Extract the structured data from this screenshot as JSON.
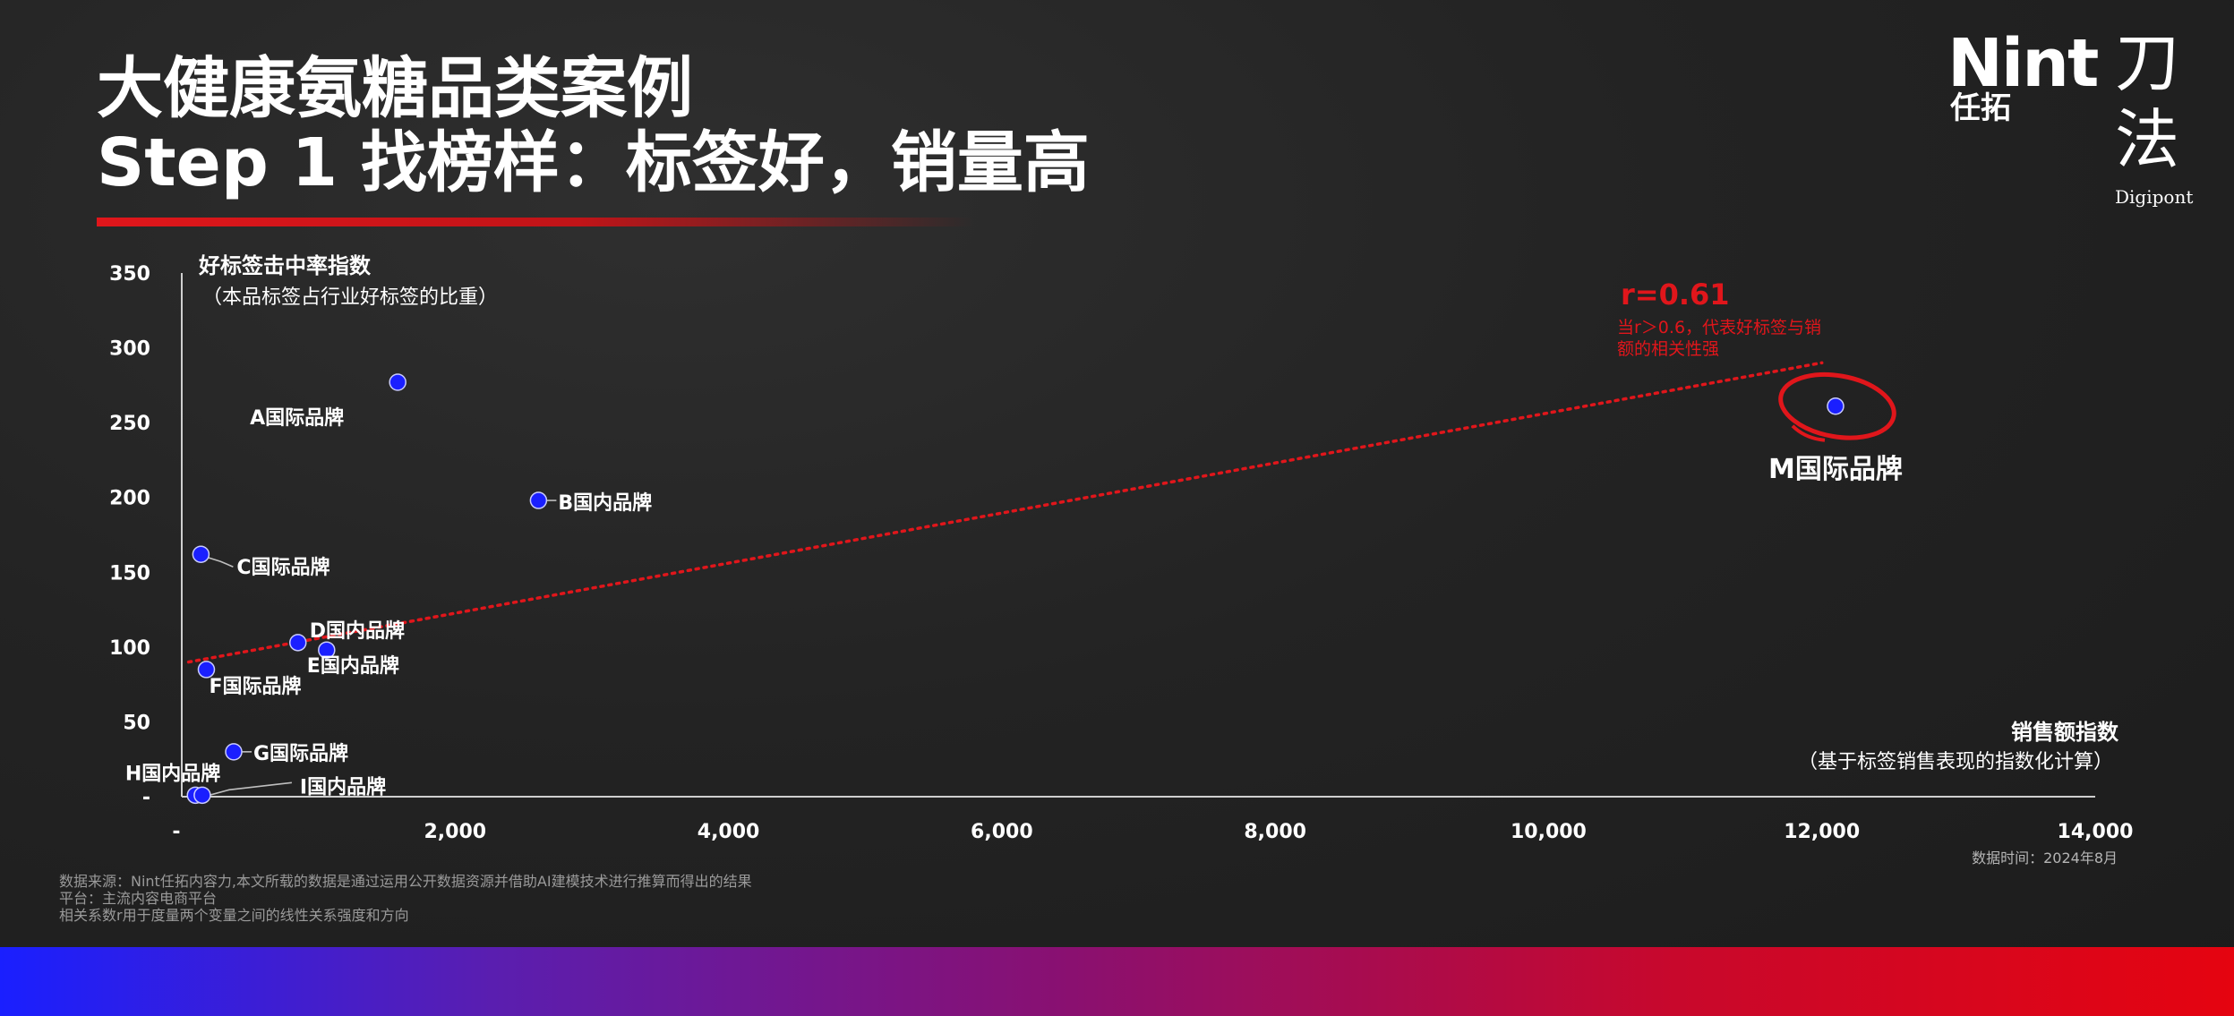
{
  "header": {
    "title_line1": "大健康氨糖品类案例",
    "title_line2": "Step 1 找榜样：标签好，销量高"
  },
  "brand": {
    "nint": "Nint",
    "nint_cn": "任拓",
    "dao_line1": "刀",
    "dao_line2": "法",
    "digipont": "Digipont"
  },
  "colors": {
    "background": "#222222",
    "point": "#1a1fff",
    "accent_red": "#e0161b",
    "text": "#ffffff"
  },
  "chart_data": {
    "type": "scatter",
    "title": "",
    "ylabel": "好标签击中率指数",
    "ylabel_sub": "（本品标签占行业好标签的比重）",
    "xlabel": "销售额指数",
    "xlabel_sub": "（基于标签销售表现的指数化计算）",
    "xlim": [
      0,
      14000
    ],
    "ylim": [
      0,
      350
    ],
    "x_ticks": [
      0,
      2000,
      4000,
      6000,
      8000,
      10000,
      12000,
      14000
    ],
    "x_tick_labels": [
      "-",
      "2,000",
      "4,000",
      "6,000",
      "8,000",
      "10,000",
      "12,000",
      "14,000"
    ],
    "y_ticks": [
      0,
      50,
      100,
      150,
      200,
      250,
      300,
      350
    ],
    "y_tick_labels": [
      "-",
      "50",
      "100",
      "150",
      "200",
      "250",
      "300",
      "350"
    ],
    "grid": false,
    "points": [
      {
        "label": "A国际品牌",
        "x": 1580,
        "y": 277
      },
      {
        "label": "B国内品牌",
        "x": 2610,
        "y": 198
      },
      {
        "label": "C国际品牌",
        "x": 140,
        "y": 162
      },
      {
        "label": "D国内品牌",
        "x": 850,
        "y": 103
      },
      {
        "label": "E国内品牌",
        "x": 1060,
        "y": 98
      },
      {
        "label": "F国际品牌",
        "x": 180,
        "y": 85
      },
      {
        "label": "G国际品牌",
        "x": 380,
        "y": 30
      },
      {
        "label": "H国内品牌",
        "x": 100,
        "y": 1
      },
      {
        "label": "I国内品牌",
        "x": 150,
        "y": 1
      },
      {
        "label": "M国际品牌",
        "x": 12100,
        "y": 261
      }
    ],
    "trendline": {
      "x": [
        50,
        12000
      ],
      "y": [
        90,
        290
      ]
    },
    "annotation": {
      "r_value": "r=0.61",
      "note_line1": "当r＞0.6，代表好标签与销",
      "note_line2": "额的相关性强"
    }
  },
  "footer": {
    "source_line1": "数据来源：Nint任拓内容力,本文所载的数据是通过运用公开数据资源并借助AI建模技术进行推算而得出的结果",
    "source_line2": "平台：主流内容电商平台",
    "source_line3": "相关系数r用于度量两个变量之间的线性关系强度和方向",
    "data_time": "数据时间：2024年8月"
  }
}
